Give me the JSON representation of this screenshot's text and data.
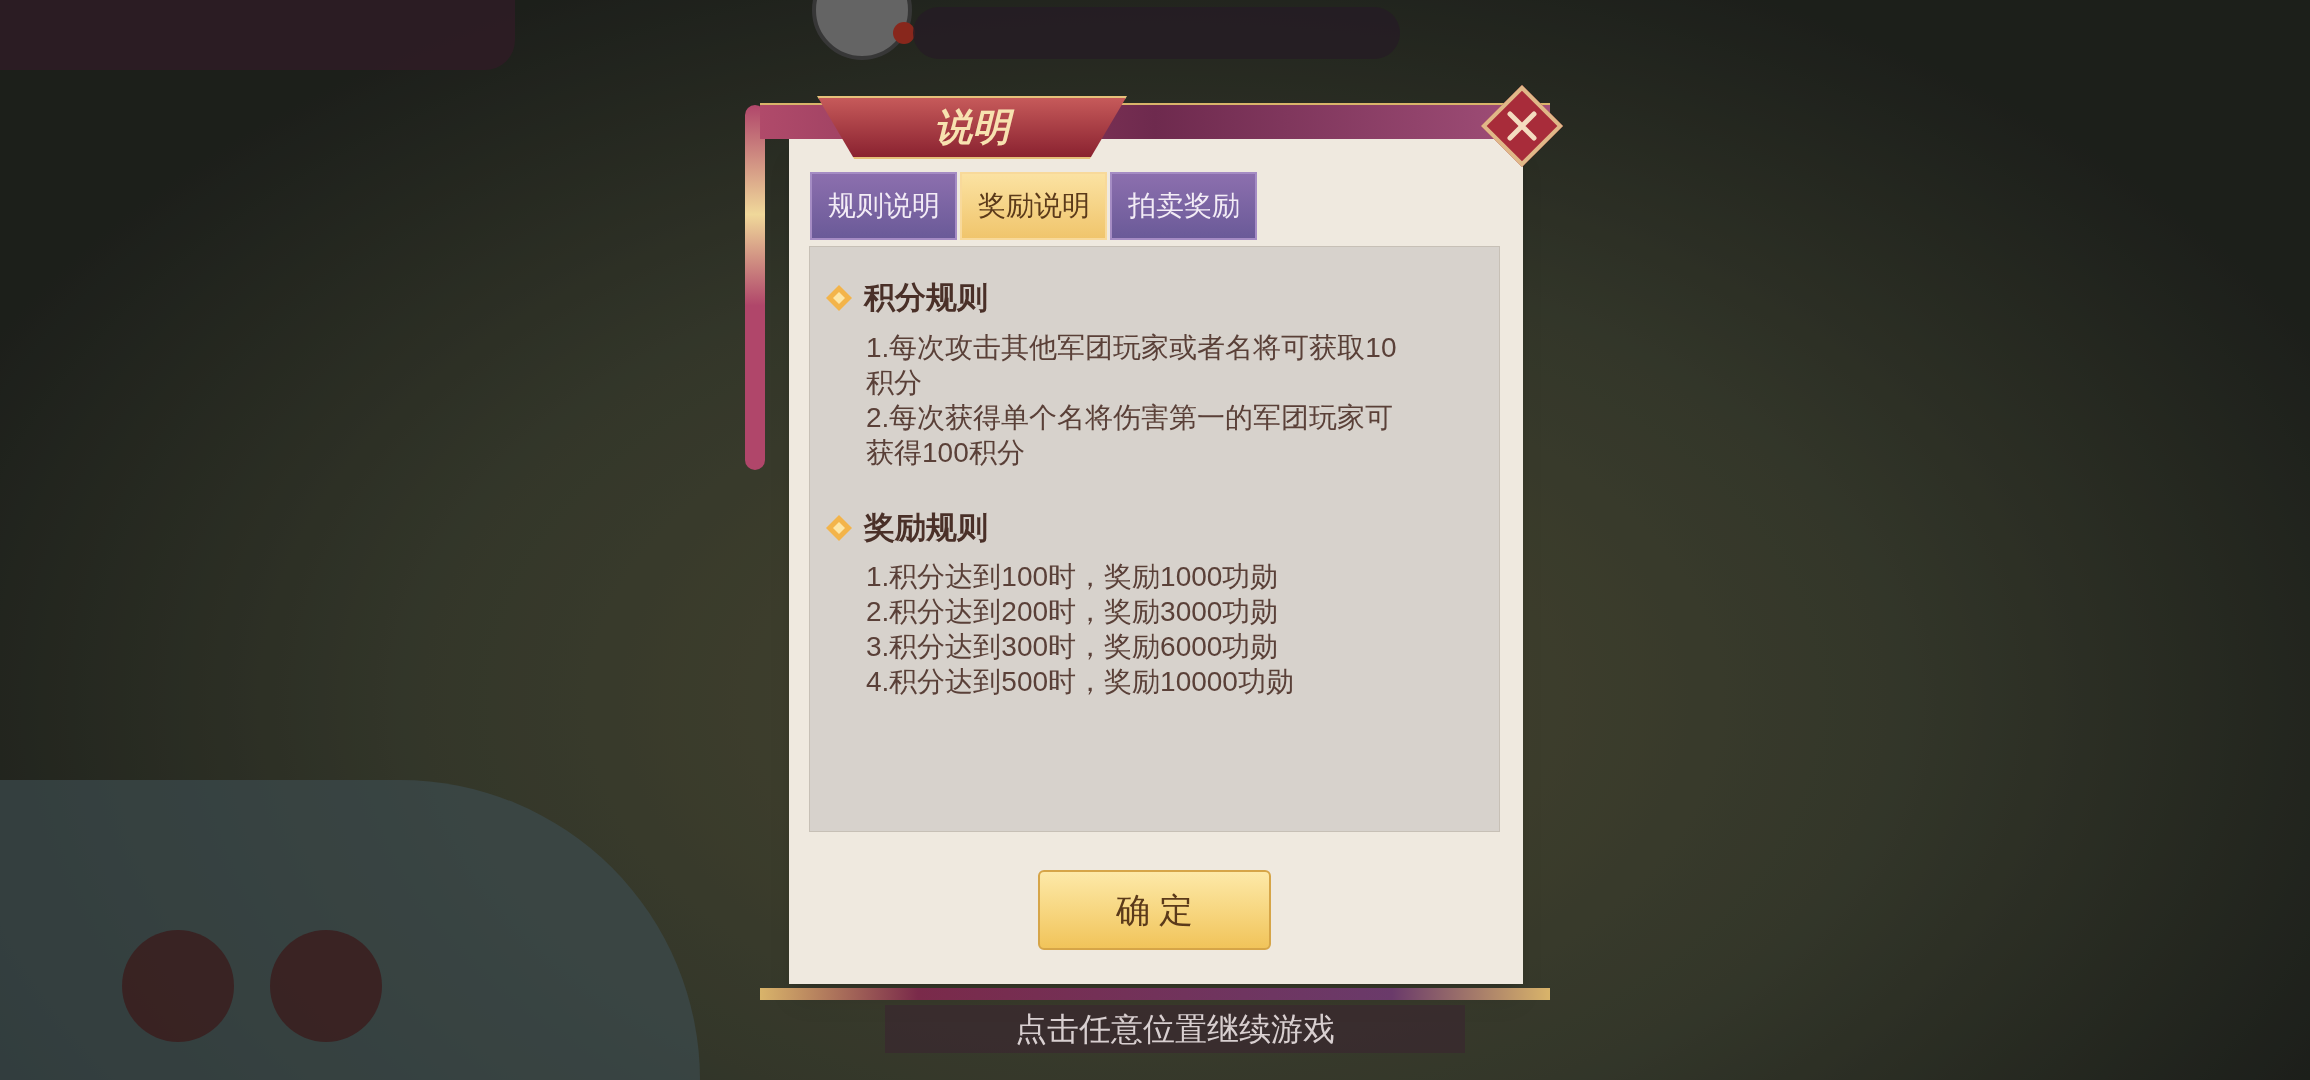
{
  "dialog": {
    "title": "说明",
    "tabs": [
      {
        "label": "规则说明",
        "selected": false
      },
      {
        "label": "奖励说明",
        "selected": true
      },
      {
        "label": "拍卖奖励",
        "selected": false
      }
    ],
    "sections": [
      {
        "heading": "积分规则",
        "items": [
          "1.每次攻击其他军团玩家或者名将可获取10积分",
          "2.每次获得单个名将伤害第一的军团玩家可获得100积分"
        ]
      },
      {
        "heading": "奖励规则",
        "items": [
          "1.积分达到100时，奖励1000功勋",
          "2.积分达到200时，奖励3000功勋",
          "3.积分达到300时，奖励6000功勋",
          "4.积分达到500时，奖励10000功勋"
        ]
      }
    ],
    "confirm_button": "确 定"
  },
  "hint": "点击任意位置继续游戏"
}
